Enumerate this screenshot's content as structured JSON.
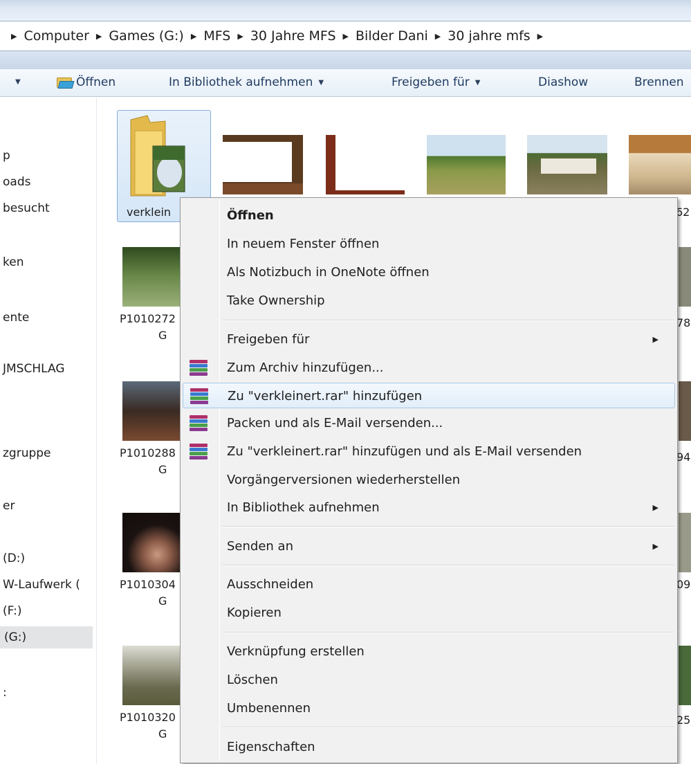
{
  "breadcrumb": {
    "items": [
      "Computer",
      "Games (G:)",
      "MFS",
      "30 Jahre MFS",
      "Bilder Dani",
      "30 jahre mfs"
    ]
  },
  "toolbar": {
    "open_label": "Öffnen",
    "library_label": "In Bibliothek aufnehmen",
    "share_label": "Freigeben für",
    "slideshow_label": "Diashow",
    "burn_label": "Brennen"
  },
  "nav": {
    "items": [
      "",
      "p",
      "oads",
      "besucht",
      "ken",
      "ente",
      "JMSCHLAG",
      "zgruppe",
      "er",
      "(D:)",
      "W-Laufwerk (",
      "(F:)",
      "(G:)",
      ":"
    ]
  },
  "files": {
    "folder_name": "verklein",
    "row1_partial": "62",
    "row2": {
      "name": "P1010272",
      "ext": "G",
      "right": "78"
    },
    "row3": {
      "name": "P1010288",
      "ext": "G",
      "right": "94"
    },
    "row4": {
      "name": "P1010304",
      "ext": "G",
      "right": "09"
    },
    "row5": {
      "name": "P1010320",
      "ext": "G",
      "right": "25"
    }
  },
  "context_menu": {
    "open": "Öffnen",
    "open_new_window": "In neuem Fenster öffnen",
    "open_onenote": "Als Notizbuch in OneNote öffnen",
    "take_ownership": "Take Ownership",
    "share_with": "Freigeben für",
    "add_archive": "Zum Archiv hinzufügen...",
    "add_to_rar": "Zu \"verkleinert.rar\" hinzufügen",
    "pack_email": "Packen und als E-Mail versenden...",
    "add_rar_email": "Zu \"verkleinert.rar\" hinzufügen und als E-Mail versenden",
    "restore_versions": "Vorgängerversionen wiederherstellen",
    "include_library": "In Bibliothek aufnehmen",
    "send_to": "Senden an",
    "cut": "Ausschneiden",
    "copy": "Kopieren",
    "create_shortcut": "Verknüpfung erstellen",
    "delete": "Löschen",
    "rename": "Umbenennen",
    "properties": "Eigenschaften"
  },
  "colors": {
    "menu_bg": "#f1f1f1",
    "hover_border": "#a8c8e9",
    "toolbar_text": "#1e3a5f"
  }
}
